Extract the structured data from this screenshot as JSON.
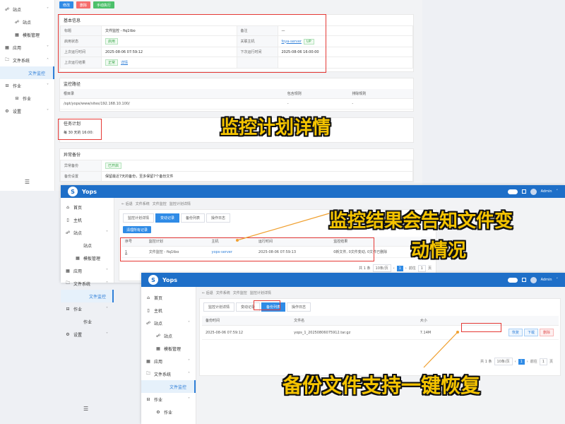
{
  "shot1": {
    "sidebar": [
      {
        "icon": "☍",
        "label": "站点",
        "chev": "˅",
        "level": 0
      },
      {
        "icon": "☍",
        "label": "站点",
        "level": 1
      },
      {
        "icon": "▦",
        "label": "模板管理",
        "level": 1
      },
      {
        "icon": "▦",
        "label": "应用",
        "chev": "˅",
        "level": 0
      },
      {
        "icon": "🗀",
        "label": "文件系统",
        "chev": "˄",
        "level": 0
      },
      {
        "icon": "",
        "label": "文件监控",
        "level": 2,
        "active": true
      },
      {
        "icon": "⊟",
        "label": "作业",
        "chev": "˅",
        "level": 0
      },
      {
        "icon": "⊟",
        "label": "作业",
        "level": 1
      },
      {
        "icon": "⚙",
        "label": "设置",
        "chev": "˅",
        "level": 0
      }
    ],
    "buttons": [
      "修改",
      "删除",
      "手动执行"
    ],
    "basic": {
      "title": "基本信息",
      "rows": [
        {
          "k1": "标题",
          "v1": "文件监控 - fiq1tbo",
          "k2": "备注",
          "v2": "—"
        },
        {
          "k1": "启用状态",
          "v1": "启用",
          "k2": "关联主机",
          "v2": "foya-server",
          "v2tag": "UP"
        },
        {
          "k1": "上次运行时间",
          "v1": "2025-08-06 07:59:12",
          "k2": "下次运行时间",
          "v2": "2025-08-06 16:00:00"
        },
        {
          "k1": "上次运行结果",
          "v1": "正常",
          "v1link": "详情",
          "k2": "",
          "v2": ""
        }
      ]
    },
    "monitor": {
      "title": "监控路径",
      "headers": [
        "根目录",
        "包含规则",
        "排除规则"
      ],
      "row": [
        "/opt/yops/www/sites/192.168.10.100/",
        "-",
        "-"
      ]
    },
    "task": {
      "title": "任务计划",
      "text": "每 30 天的 16:00:"
    },
    "backup": {
      "title": "异常备份",
      "rows": [
        {
          "k": "异常备份",
          "v": "已开启"
        },
        {
          "k": "备份设置",
          "v": "保留最近7天的备份，至多保留7个备份文件"
        }
      ]
    }
  },
  "shot2": {
    "brand": "Yops",
    "user": "Admin",
    "breadcrumb": [
      "← 后退",
      "文件系统",
      "文件监控",
      "监控计划详情"
    ],
    "sidebar": [
      {
        "icon": "⌂",
        "label": "首页",
        "level": 0
      },
      {
        "icon": "▯",
        "label": "主机",
        "level": 0
      },
      {
        "icon": "☍",
        "label": "站点",
        "chev": "˅",
        "level": 0
      },
      {
        "icon": "",
        "label": "站点",
        "level": 1
      },
      {
        "icon": "▦",
        "label": "模板管理",
        "level": 1
      },
      {
        "icon": "▦",
        "label": "应用",
        "chev": "˅",
        "level": 0
      },
      {
        "icon": "🗀",
        "label": "文件系统",
        "chev": "˄",
        "level": 0
      },
      {
        "icon": "",
        "label": "文件监控",
        "level": 2,
        "active": true
      },
      {
        "icon": "⊟",
        "label": "作业",
        "chev": "˅",
        "level": 0
      },
      {
        "icon": "",
        "label": "作业",
        "level": 1
      },
      {
        "icon": "⚙",
        "label": "设置",
        "chev": "˅",
        "level": 0
      }
    ],
    "tabs": [
      "监控计划详情",
      "变动记录",
      "备份列表",
      "操作日志"
    ],
    "active_tab": 1,
    "action": "清理所有记录",
    "headers": [
      "序号",
      "监控计划",
      "主机",
      "运行时间",
      "监控结果"
    ],
    "row": [
      "1",
      "文件监控 - fiq1tbo",
      "yops-server",
      "2025-08-06 07:59:13",
      "0新文件, 0文件变动, 0文件已删除"
    ],
    "pager": {
      "total": "共 1 条",
      "size": "10条/页",
      "page": "1",
      "goto": "前往",
      "goto_val": "1",
      "unit": "页"
    }
  },
  "shot3": {
    "brand": "Yops",
    "user": "Admin",
    "breadcrumb": [
      "← 后退",
      "文件系统",
      "文件监控",
      "监控计划详情"
    ],
    "sidebar": [
      {
        "icon": "⌂",
        "label": "首页",
        "level": 0
      },
      {
        "icon": "▯",
        "label": "主机",
        "level": 0
      },
      {
        "icon": "☍",
        "label": "站点",
        "chev": "˅",
        "level": 0
      },
      {
        "icon": "☍",
        "label": "站点",
        "level": 1
      },
      {
        "icon": "▦",
        "label": "模板管理",
        "level": 1
      },
      {
        "icon": "▦",
        "label": "应用",
        "chev": "˅",
        "level": 0
      },
      {
        "icon": "🗀",
        "label": "文件系统",
        "chev": "˄",
        "level": 0
      },
      {
        "icon": "",
        "label": "文件监控",
        "level": 2,
        "active": true
      },
      {
        "icon": "⊟",
        "label": "作业",
        "chev": "˅",
        "level": 0
      },
      {
        "icon": "⚙",
        "label": "作业",
        "level": 1
      }
    ],
    "tabs": [
      "监控计划详情",
      "变动记录",
      "备份列表",
      "操作日志"
    ],
    "active_tab": 2,
    "headers": [
      "备份时间",
      "文件名",
      "大小",
      ""
    ],
    "row": [
      "2025-08-06 07:59:12",
      "yops_1_20250806075912.tar.gz",
      "7.14M"
    ],
    "row_actions": [
      "恢复",
      "下载",
      "删除"
    ],
    "pager": {
      "total": "共 1 条",
      "size": "10条/页",
      "page": "1",
      "goto": "前往",
      "goto_val": "1",
      "unit": "页"
    }
  },
  "captions": {
    "c1": "监控计划详情",
    "c2a": "监控结果会告知文件变",
    "c2b": "动情况",
    "c3": "备份文件支持一键恢复"
  },
  "colors": {
    "accent": "#2f8be6",
    "topbar": "#1e6fc8",
    "highlight": "#e53935",
    "caption": "#f5c400"
  }
}
